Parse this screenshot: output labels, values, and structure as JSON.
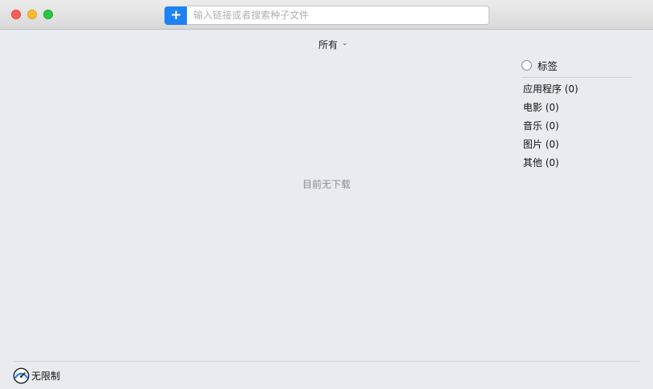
{
  "toolbar": {
    "add_label": "+",
    "search_placeholder": "输入链接或者搜索种子文件"
  },
  "filter": {
    "label": "所有"
  },
  "sidebar": {
    "tags_label": "标签",
    "categories": [
      "应用程序 (0)",
      "电影 (0)",
      "音乐 (0)",
      "图片 (0)",
      "其他 (0)"
    ]
  },
  "main": {
    "empty_message": "目前无下载"
  },
  "footer": {
    "speed_label": "无限制"
  },
  "colors": {
    "accent": "#1f82f4",
    "background": "#e8ebf0"
  }
}
